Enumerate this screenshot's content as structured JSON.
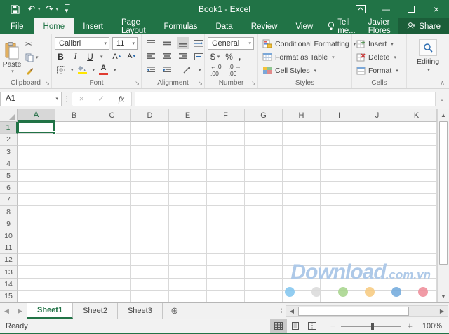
{
  "colors": {
    "excel_green": "#217346",
    "fill_color_swatch": "#ffe600",
    "font_color_swatch": "#e03c31",
    "watermark_blue": "#aec9e8",
    "watermark_dots": [
      "#7fc4ee",
      "#d9d9d9",
      "#a5d38a",
      "#f7c97d",
      "#6fa8dc",
      "#ef8a96"
    ]
  },
  "title_bar": {
    "title": "Book1 - Excel"
  },
  "ribbon_tabs": {
    "items": [
      "File",
      "Home",
      "Insert",
      "Page Layout",
      "Formulas",
      "Data",
      "Review",
      "View"
    ],
    "active": "Home",
    "tell_me": "Tell me...",
    "user_name": "Javier Flores",
    "share": "Share"
  },
  "ribbon": {
    "clipboard": {
      "label": "Clipboard",
      "paste": "Paste"
    },
    "font": {
      "label": "Font",
      "font_name": "Calibri",
      "font_size": "11",
      "bold": "B",
      "italic": "I",
      "underline": "U"
    },
    "alignment": {
      "label": "Alignment"
    },
    "number": {
      "label": "Number",
      "format": "General",
      "currency": "$",
      "percent": "%",
      "comma": ","
    },
    "styles": {
      "label": "Styles",
      "items": [
        "Conditional Formatting",
        "Format as Table",
        "Cell Styles"
      ]
    },
    "cells": {
      "label": "Cells",
      "items": [
        "Insert",
        "Delete",
        "Format"
      ]
    },
    "editing": {
      "label": "Editing"
    }
  },
  "formula_bar": {
    "name_box": "A1",
    "fx": "fx",
    "value": ""
  },
  "grid": {
    "columns": [
      "A",
      "B",
      "C",
      "D",
      "E",
      "F",
      "G",
      "H",
      "I",
      "J",
      "K"
    ],
    "rows": [
      "1",
      "2",
      "3",
      "4",
      "5",
      "6",
      "7",
      "8",
      "9",
      "10",
      "11",
      "12",
      "13",
      "14",
      "15"
    ],
    "selected_cell": "A1",
    "selected_column": "A",
    "selected_row": "1"
  },
  "watermark": {
    "main": "Download",
    "suffix": ".com.vn"
  },
  "sheet_bar": {
    "tabs": [
      "Sheet1",
      "Sheet2",
      "Sheet3"
    ],
    "active": "Sheet1"
  },
  "status_bar": {
    "status": "Ready",
    "zoom": "100%"
  }
}
